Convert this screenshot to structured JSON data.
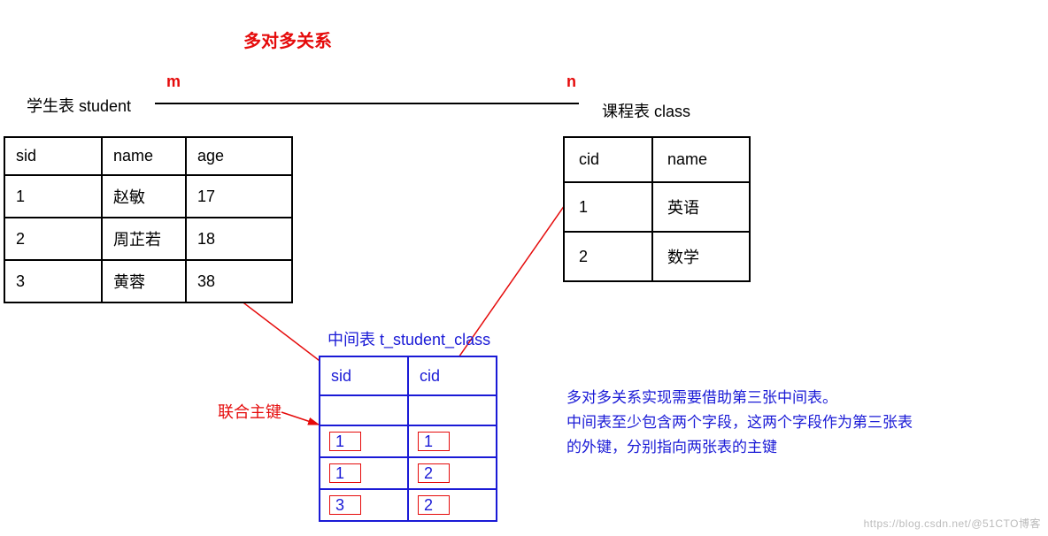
{
  "title": "多对多关系",
  "relation": {
    "left": "m",
    "right": "n"
  },
  "watermark": "https://blog.csdn.net/@51CTO博客",
  "student_table": {
    "label": "学生表  student",
    "columns": [
      "sid",
      "name",
      "age"
    ],
    "rows": [
      {
        "sid": "1",
        "name": "赵敏",
        "age": "17"
      },
      {
        "sid": "2",
        "name": "周芷若",
        "age": "18"
      },
      {
        "sid": "3",
        "name": "黄蓉",
        "age": "38"
      }
    ]
  },
  "class_table": {
    "label": "课程表    class",
    "columns": [
      "cid",
      "name"
    ],
    "rows": [
      {
        "cid": "1",
        "name": "英语"
      },
      {
        "cid": "2",
        "name": "数学"
      }
    ]
  },
  "middle_table": {
    "label": "中间表  t_student_class",
    "composite_key_label": "联合主键",
    "columns": [
      "sid",
      "cid"
    ],
    "rows": [
      {
        "sid": "1",
        "cid": "1"
      },
      {
        "sid": "1",
        "cid": "2"
      },
      {
        "sid": "3",
        "cid": "2"
      }
    ]
  },
  "description": {
    "line1": "多对多关系实现需要借助第三张中间表。",
    "line2": "中间表至少包含两个字段，这两个字段作为第三张表",
    "line3": "的外键，分别指向两张表的主键"
  }
}
